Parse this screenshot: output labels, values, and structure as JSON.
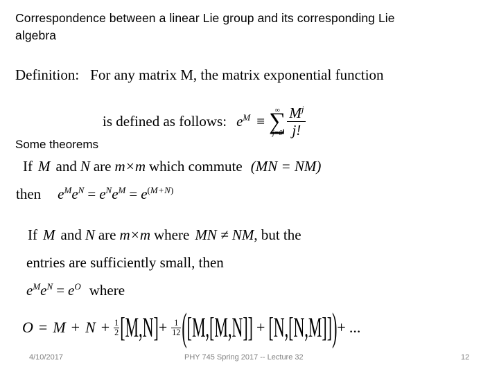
{
  "slide": {
    "title": "Correspondence between a linear Lie group and its corresponding Lie algebra",
    "definition": {
      "label": "Definition:",
      "line1_text": "For any matrix M, the matrix exponential function",
      "line2_text": "is defined as follows:",
      "lhs_base": "e",
      "lhs_exp": "M",
      "relation": "≡",
      "sum_upper": "∞",
      "sum_symbol": "∑",
      "sum_lower": "j=0",
      "fraction_numerator_base": "M",
      "fraction_numerator_exp": "j",
      "fraction_denominator": "j!"
    },
    "theorems_heading": "Some theorems",
    "theorem1": {
      "line1_a": "If",
      "line1_M": "M",
      "line1_b": "and",
      "line1_N": "N",
      "line1_c": "are",
      "line1_dim": "m×m",
      "line1_d": "which commute",
      "line1_paren": "(MN = NM)",
      "line2_then": "then",
      "line2_eq": "e^M e^N = e^N e^M = e^(M+N)"
    },
    "theorem2": {
      "line1_a": "If",
      "line1_M": "M",
      "line1_b": "and",
      "line1_N": "N",
      "line1_c": "are",
      "line1_dim": "m×m",
      "line1_d": "where",
      "line1_neq": "MN ≠ NM",
      "line1_e": ", but the",
      "line2": "entries are sufficiently small, then",
      "line3_eq": "e^M e^N = e^O",
      "line3_where": "where"
    },
    "bch": {
      "lhs": "O",
      "equals": "=",
      "term_M": "M",
      "plus1": "+",
      "term_N": "N",
      "plus2": "+",
      "half_num": "1",
      "half_den": "2",
      "bracket1": "[M,N]",
      "plus3": "+",
      "twelfth_num": "1",
      "twelfth_den": "12",
      "group_open": "(",
      "bracket2": "[M,[M,N]]",
      "plus4": "+",
      "bracket3": "[N,[N,M]]",
      "group_close": ")",
      "plus5": "+",
      "ellipsis": "..."
    }
  },
  "footer": {
    "date": "4/10/2017",
    "center": "PHY 745  Spring 2017 -- Lecture 32",
    "page": "12"
  }
}
